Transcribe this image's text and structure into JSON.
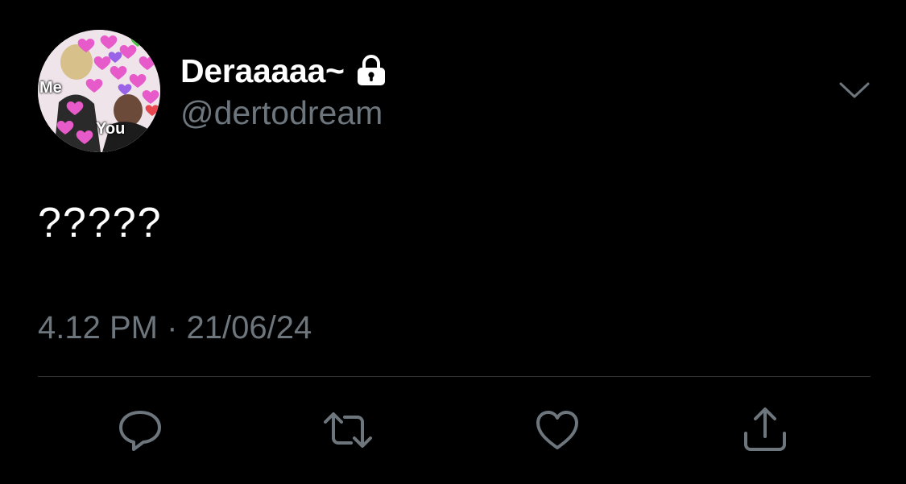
{
  "tweet": {
    "author": {
      "display_name": "Deraaaaa~",
      "handle": "@dertodream",
      "protected": true,
      "avatar": {
        "label_top": "Me",
        "label_bottom": "You"
      }
    },
    "text": "?????",
    "timestamp": "4.12 PM · 21/06/24"
  },
  "icons": {
    "lock": "lock-icon",
    "menu": "chevron-down-icon",
    "reply": "reply-icon",
    "retweet": "retweet-icon",
    "like": "heart-icon",
    "share": "share-icon"
  },
  "colors": {
    "background": "#000000",
    "primary_text": "#ffffff",
    "secondary_text": "#6e767d",
    "divider": "#2f3336"
  }
}
